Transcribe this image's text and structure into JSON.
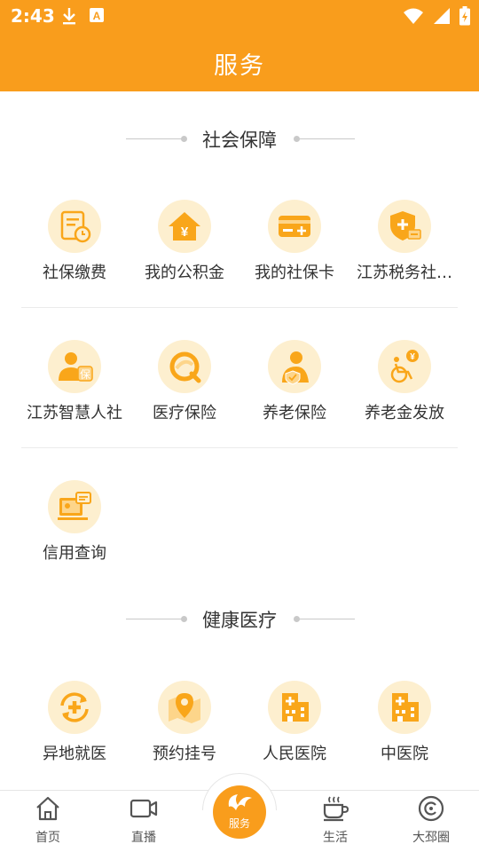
{
  "status_bar": {
    "time": "2:43",
    "icons_left": [
      "download-icon",
      "a-notification-icon"
    ],
    "icons_right": [
      "wifi-icon",
      "signal-icon",
      "battery-icon"
    ]
  },
  "header": {
    "title": "服务"
  },
  "colors": {
    "accent": "#f99d1c",
    "icon_bg": "#fdefcf",
    "icon_fg": "#f9a61a"
  },
  "sections": [
    {
      "title": "社会保障",
      "items": [
        {
          "label": "社保缴费",
          "icon": "bill-clock-icon"
        },
        {
          "label": "我的公积金",
          "icon": "house-yen-icon"
        },
        {
          "label": "我的社保卡",
          "icon": "card-plus-icon"
        },
        {
          "label": "江苏税务社…",
          "icon": "shield-card-icon"
        },
        {
          "label": "江苏智慧人社",
          "icon": "person-bao-icon"
        },
        {
          "label": "医疗保险",
          "icon": "medical-swirl-icon"
        },
        {
          "label": "养老保险",
          "icon": "elder-shield-icon"
        },
        {
          "label": "养老金发放",
          "icon": "wheelchair-yen-icon"
        },
        {
          "label": "信用查询",
          "icon": "credit-screen-icon"
        }
      ]
    },
    {
      "title": "健康医疗",
      "items": [
        {
          "label": "异地就医",
          "icon": "cross-arrows-icon"
        },
        {
          "label": "预约挂号",
          "icon": "map-pin-icon"
        },
        {
          "label": "人民医院",
          "icon": "hospital-icon"
        },
        {
          "label": "中医院",
          "icon": "hospital-tcm-icon"
        }
      ]
    }
  ],
  "bottom_nav": {
    "items": [
      {
        "label": "首页",
        "icon": "home-icon"
      },
      {
        "label": "直播",
        "icon": "video-camera-icon"
      },
      {
        "label": "服务",
        "icon": "service-leaf-icon"
      },
      {
        "label": "生活",
        "icon": "coffee-cup-icon"
      },
      {
        "label": "大邳圈",
        "icon": "circle-target-icon"
      }
    ]
  }
}
